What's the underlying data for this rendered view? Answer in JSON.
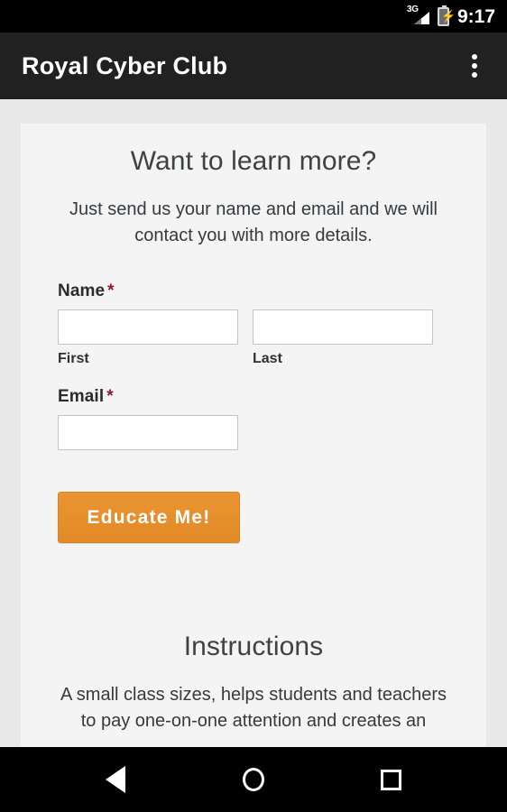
{
  "status_bar": {
    "network_type": "3G",
    "signal_icon": "signal-bars-icon",
    "battery_icon": "battery-charging-icon",
    "time": "9:17"
  },
  "app_bar": {
    "title": "Royal Cyber Club",
    "overflow_icon": "overflow-menu-icon"
  },
  "content": {
    "lead": {
      "heading": "Want to learn more?",
      "body": "Just send us your name and email and we will contact you with more details."
    },
    "form": {
      "name": {
        "label": "Name",
        "required_mark": "*",
        "first": {
          "value": "",
          "placeholder": "",
          "sub_label": "First"
        },
        "last": {
          "value": "",
          "placeholder": "",
          "sub_label": "Last"
        }
      },
      "email": {
        "label": "Email",
        "required_mark": "*",
        "value": "",
        "placeholder": ""
      },
      "submit_label": "Educate Me!"
    },
    "instructions": {
      "heading": "Instructions",
      "body": "A small class sizes, helps students and teachers to pay one-on-one attention and creates an"
    }
  },
  "nav_bar": {
    "back_icon": "back-triangle-icon",
    "home_icon": "home-circle-icon",
    "recents_icon": "recents-square-icon"
  },
  "colors": {
    "accent_orange": "#e68a27",
    "required_red": "#8c1d2e",
    "app_bar": "#212121",
    "page_bg": "#e8e8e8",
    "card_bg": "#f4f4f4"
  }
}
